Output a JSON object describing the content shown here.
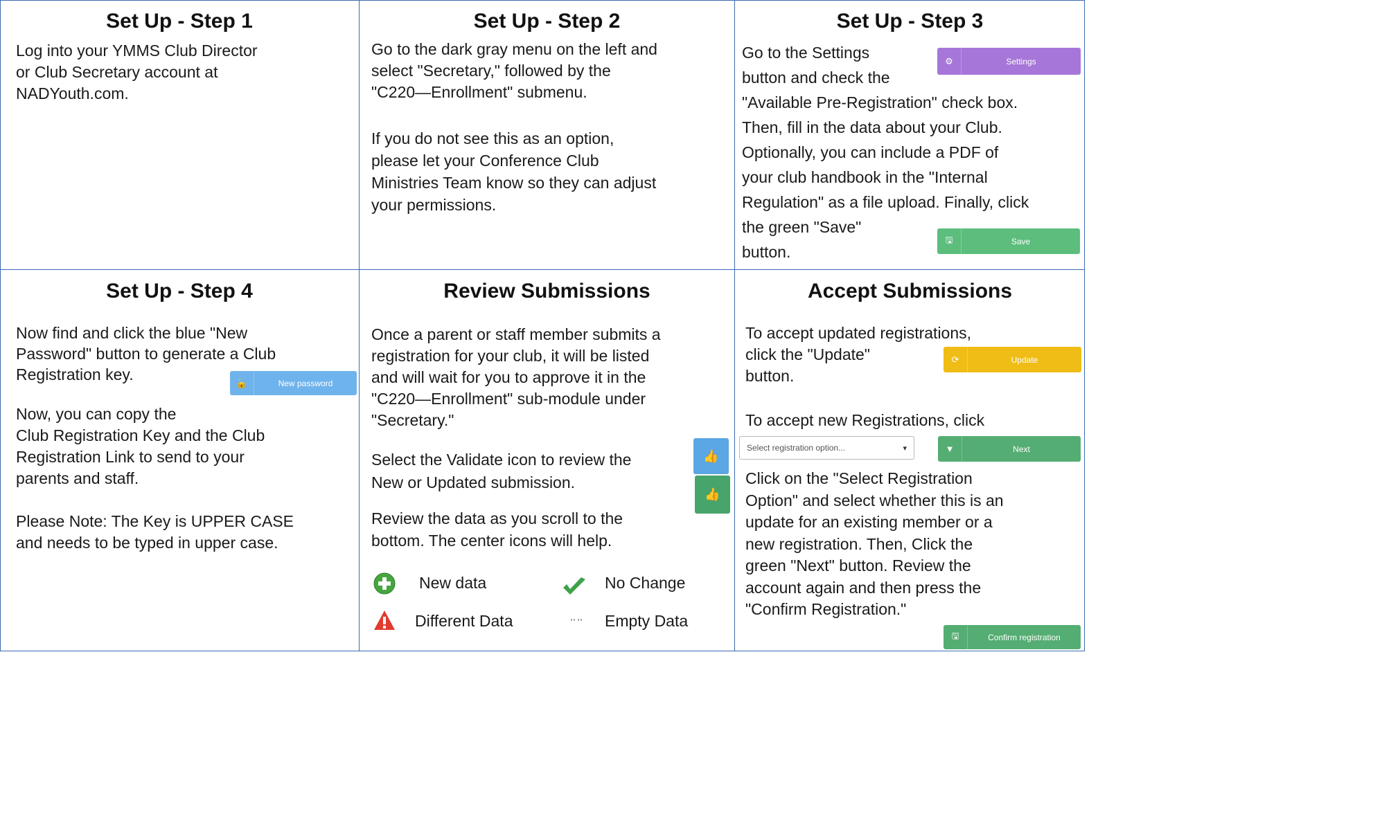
{
  "colors": {
    "border": "#3b6ab3",
    "settings_btn": "#a676d8",
    "save_btn": "#5cbd7d",
    "new_password_btn": "#6fb3ec",
    "update_btn": "#efbd15",
    "next_btn": "#54ad72",
    "validate_blue": "#5ba6e4",
    "validate_green": "#47a46b"
  },
  "step1": {
    "title": "Set Up - Step 1",
    "lines": [
      "Log into your YMMS Club Director",
      "or Club Secretary account at",
      "NADYouth.com."
    ]
  },
  "step2": {
    "title": "Set Up - Step 2",
    "para1": [
      "Go to the dark gray menu on the left and",
      "select \"Secretary,\" followed by the",
      "\"C220—Enrollment\" submenu."
    ],
    "para2": [
      "If you do not see this as an option,",
      "please let your Conference Club",
      "Ministries Team know so they can adjust",
      "your permissions."
    ]
  },
  "step3": {
    "title": "Set Up - Step 3",
    "lines": [
      "Go to the Settings",
      "button and check the",
      "\"Available Pre-Registration\" check box.",
      "Then, fill in the data about your Club.",
      "Optionally, you can include a PDF of",
      "your club handbook in the \"Internal",
      "Regulation\" as a file upload. Finally, click",
      "the green \"Save\"",
      "button."
    ],
    "settings_label": "Settings",
    "save_label": "Save"
  },
  "step4": {
    "title": "Set Up - Step 4",
    "para1": [
      "Now find and click the blue \"New",
      "Password\" button to generate a Club",
      "Registration key."
    ],
    "para2": [
      "Now, you can copy the",
      "Club Registration Key and the Club",
      "Registration Link to send to your",
      "parents and staff."
    ],
    "para3": [
      "Please Note: The Key is UPPER CASE",
      "and needs to be typed in upper case."
    ],
    "new_password_label": "New password"
  },
  "review": {
    "title": "Review Submissions",
    "para1": [
      "Once a parent or staff member submits a",
      "registration for your club, it will be listed",
      "and will wait for you to approve it in the",
      "\"C220—Enrollment\" sub-module under",
      "\"Secretary.\""
    ],
    "para2": [
      "Select the Validate icon to review the",
      "New or Updated submission."
    ],
    "para3": [
      "Review the data as you scroll to the",
      "bottom. The center icons will help."
    ],
    "legend": {
      "new_data": "New data",
      "no_change": "No Change",
      "different_data": "Different Data",
      "empty_data": "Empty Data"
    }
  },
  "accept": {
    "title": "Accept Submissions",
    "para1": [
      "To accept updated registrations,",
      "click the \"Update\"",
      "button."
    ],
    "para2": "To accept new Registrations, click",
    "para3": [
      "Click on the \"Select Registration",
      "Option\" and select whether this is an",
      "update for an existing member or a",
      "new registration. Then, Click the",
      "green \"Next\" button. Review the",
      "account again and then press the",
      "\"Confirm Registration.\""
    ],
    "update_label": "Update",
    "select_placeholder": "Select registration option...",
    "next_label": "Next",
    "confirm_label": "Confirm registration"
  }
}
